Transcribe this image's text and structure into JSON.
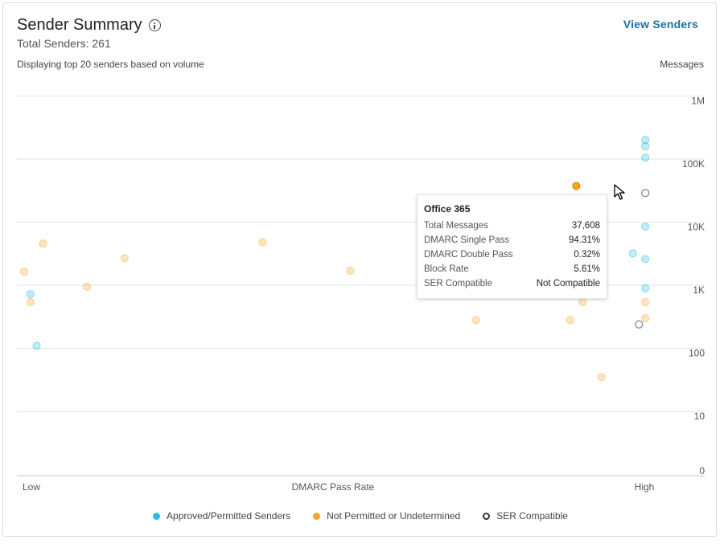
{
  "header": {
    "title": "Sender Summary",
    "total_senders": "Total Senders: 261",
    "view_link": "View Senders",
    "subtitle": "Displaying top 20 senders based on volume",
    "y_caption": "Messages"
  },
  "chart_data": {
    "type": "scatter",
    "x_axis_label": "DMARC Pass Rate",
    "x_axis_low": "Low",
    "x_axis_high": "High",
    "y_scale": "log",
    "y_ticks": [
      {
        "label": "0",
        "value": 0
      },
      {
        "label": "10",
        "value": 10
      },
      {
        "label": "100",
        "value": 100
      },
      {
        "label": "1K",
        "value": 1000
      },
      {
        "label": "10K",
        "value": 10000
      },
      {
        "label": "100K",
        "value": 100000
      },
      {
        "label": "1M",
        "value": 1000000
      }
    ],
    "grid": true,
    "legend_position": "bottom",
    "series": [
      {
        "name": "Approved/Permitted Senders",
        "color": "#29c0e0",
        "points": [
          {
            "x": 0.01,
            "y": 720
          },
          {
            "x": 0.02,
            "y": 110
          },
          {
            "x": 0.97,
            "y": 3200
          },
          {
            "x": 0.99,
            "y": 200000
          },
          {
            "x": 0.99,
            "y": 160000
          },
          {
            "x": 0.99,
            "y": 105000
          },
          {
            "x": 0.99,
            "y": 8500
          },
          {
            "x": 0.99,
            "y": 2600
          },
          {
            "x": 0.99,
            "y": 900
          }
        ]
      },
      {
        "name": "Not Permitted or Undetermined",
        "color": "#f5a623",
        "points": [
          {
            "x": 0.0,
            "y": 1650
          },
          {
            "x": 0.01,
            "y": 540
          },
          {
            "x": 0.03,
            "y": 4600
          },
          {
            "x": 0.1,
            "y": 950
          },
          {
            "x": 0.16,
            "y": 2700
          },
          {
            "x": 0.38,
            "y": 4800
          },
          {
            "x": 0.52,
            "y": 1700
          },
          {
            "x": 0.72,
            "y": 280
          },
          {
            "x": 0.87,
            "y": 280
          },
          {
            "x": 0.89,
            "y": 540
          },
          {
            "x": 0.92,
            "y": 35
          },
          {
            "x": 0.99,
            "y": 540
          },
          {
            "x": 0.99,
            "y": 300
          },
          {
            "x": 0.88,
            "y": 37608
          }
        ]
      },
      {
        "name": "SER Compatible",
        "color": "#333333",
        "points": [
          {
            "x": 0.98,
            "y": 240
          },
          {
            "x": 0.99,
            "y": 29000
          }
        ]
      }
    ],
    "tooltip": {
      "title": "Office 365",
      "rows": [
        {
          "label": "Total Messages",
          "value": "37,608"
        },
        {
          "label": "DMARC Single Pass",
          "value": "94.31%"
        },
        {
          "label": "DMARC Double Pass",
          "value": "0.32%"
        },
        {
          "label": "Block Rate",
          "value": "5.61%"
        },
        {
          "label": "SER Compatible",
          "value": "Not Compatible"
        }
      ]
    }
  }
}
